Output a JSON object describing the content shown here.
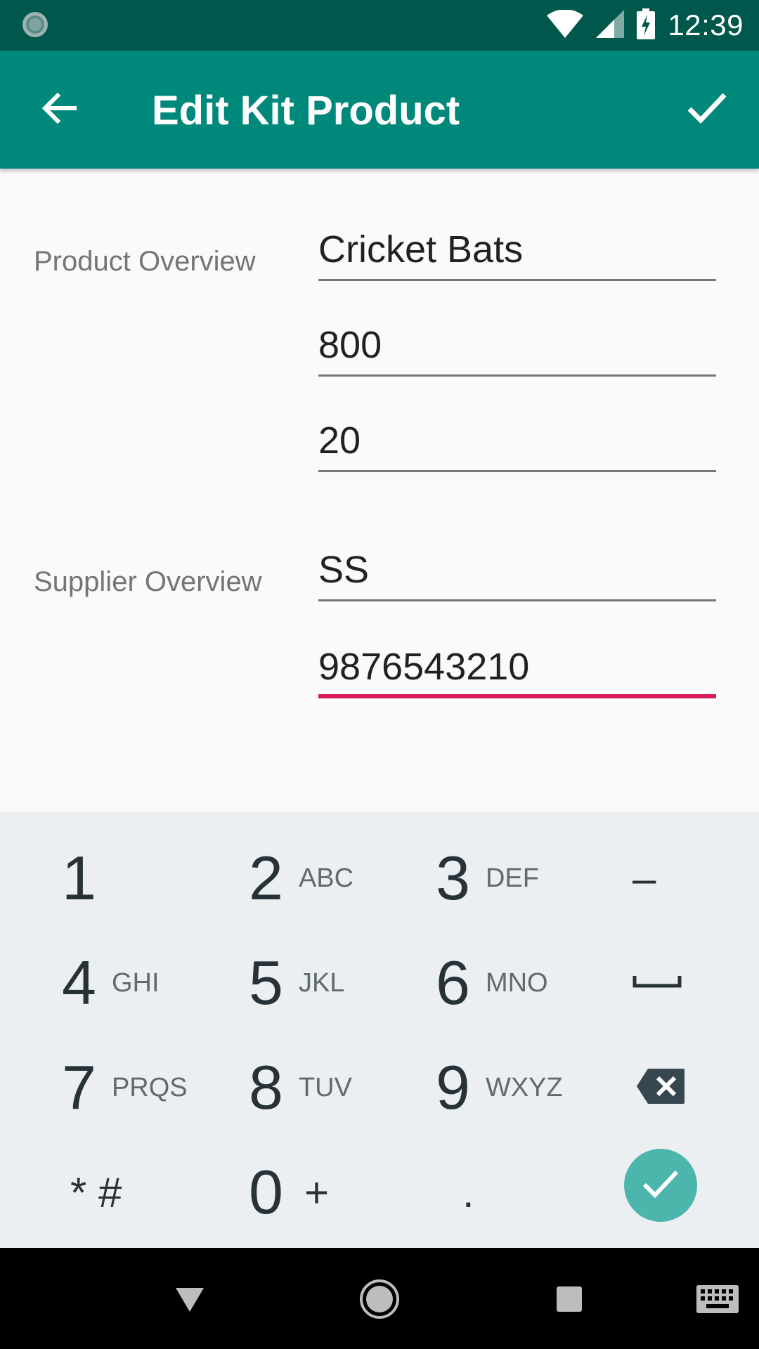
{
  "status_bar": {
    "time": "12:39",
    "icons": [
      "app-notification-icon",
      "wifi-icon",
      "signal-icon",
      "battery-charging-icon"
    ]
  },
  "app_bar": {
    "title": "Edit Kit Product",
    "back_icon": "arrow-back-icon",
    "save_icon": "check-icon"
  },
  "form": {
    "product_section_label": "Product Overview",
    "product_name": "Cricket Bats",
    "price": "800",
    "quantity": "20",
    "supplier_section_label": "Supplier Overview",
    "supplier_name": "SS",
    "supplier_phone": "9876543210",
    "accent_color": "#d81b60"
  },
  "keyboard": {
    "keys": [
      {
        "digit": "1",
        "letters": ""
      },
      {
        "digit": "2",
        "letters": "ABC"
      },
      {
        "digit": "3",
        "letters": "DEF"
      },
      {
        "symbol": "–"
      },
      {
        "digit": "4",
        "letters": "GHI"
      },
      {
        "digit": "5",
        "letters": "JKL"
      },
      {
        "digit": "6",
        "letters": "MNO"
      },
      {
        "symbol": "space"
      },
      {
        "digit": "7",
        "letters": "PRQS"
      },
      {
        "digit": "8",
        "letters": "TUV"
      },
      {
        "digit": "9",
        "letters": "WXYZ"
      },
      {
        "symbol": "backspace"
      },
      {
        "symbol": "* #"
      },
      {
        "digit": "0",
        "letters": "+"
      },
      {
        "symbol": "."
      },
      {
        "symbol": "done"
      }
    ],
    "done_color": "#4db6ac"
  },
  "nav_bar": {
    "icons": [
      "back-triangle-icon",
      "home-circle-icon",
      "recents-square-icon",
      "keyboard-icon"
    ]
  },
  "colors": {
    "status_bar": "#00574b",
    "app_bar": "#00897b",
    "keyboard_bg": "#eceff1"
  }
}
